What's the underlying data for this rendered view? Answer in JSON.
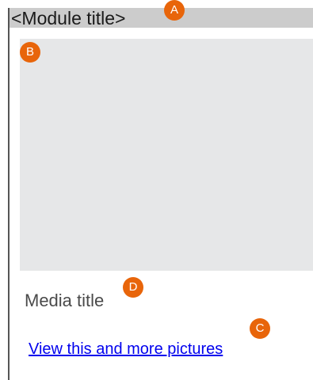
{
  "module": {
    "header_title": "<Module title>",
    "media_title": "Media title",
    "link_text": "View this and more pictures"
  },
  "annotations": {
    "a": "A",
    "b": "B",
    "c": "C",
    "d": "D"
  },
  "colors": {
    "header_bg": "#cccccc",
    "media_placeholder": "#e6e7e8",
    "badge": "#e8650a",
    "link": "#0000ee"
  }
}
